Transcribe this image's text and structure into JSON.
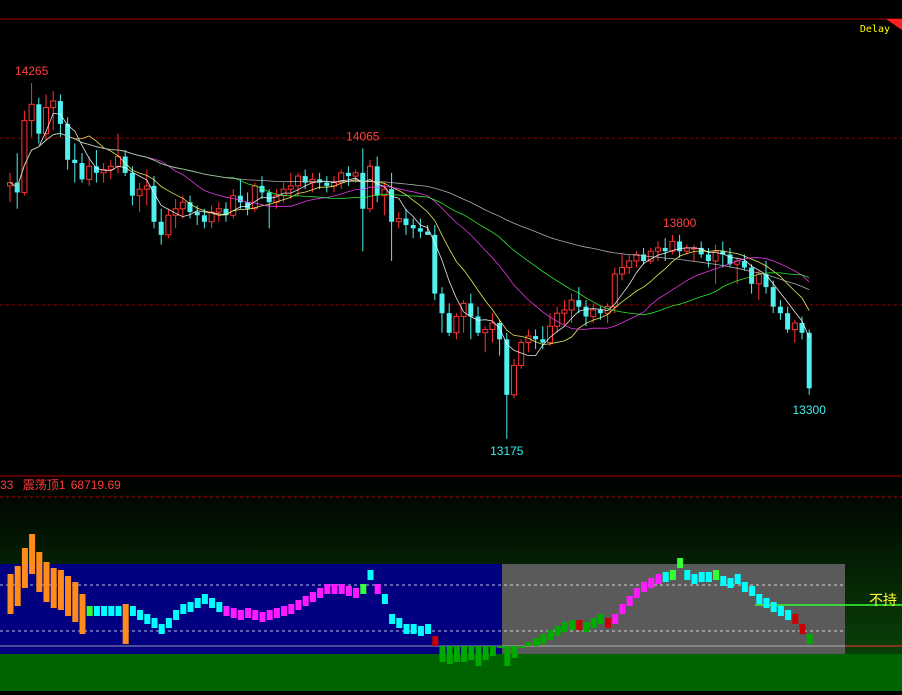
{
  "header": {
    "delay_label": "Delay"
  },
  "indicator": {
    "prefix": "33",
    "name": "震荡顶1",
    "value": "68719.69",
    "right_label": "不持"
  },
  "colors": {
    "up": "#ff3232",
    "down": "#4ef0f0",
    "label_high": "#ff4040",
    "label_low": "#3ff0f0",
    "ma5": "#ffffff",
    "ma10": "#ffff66",
    "ma20": "#ff3dff",
    "ma30": "#33ff33",
    "ma60": "#c0c0c0",
    "ind_orange": "#ff8c1a",
    "ind_cyan": "#00ffff",
    "ind_magenta": "#ff1aff",
    "ind_green": "#00aa00",
    "ind_red": "#cc0000",
    "ind_lime": "#33ff33",
    "panel_blue": "#000080",
    "panel_gray": "#5a5a5a"
  },
  "chart_data": {
    "type": "candlestick",
    "ylim": [
      13000,
      14400
    ],
    "price_labels": [
      {
        "text": "14265",
        "index": 3,
        "value": 14265,
        "kind": "high"
      },
      {
        "text": "14065",
        "index": 49,
        "value": 14065,
        "kind": "high"
      },
      {
        "text": "13800",
        "index": 93,
        "value": 13800,
        "kind": "high"
      },
      {
        "text": "13175",
        "index": 69,
        "value": 13175,
        "kind": "low"
      },
      {
        "text": "13300",
        "index": 111,
        "value": 13300,
        "kind": "low"
      }
    ],
    "candles": [
      [
        13950,
        13990,
        13900,
        13960
      ],
      [
        13960,
        14050,
        13880,
        13930
      ],
      [
        13930,
        14180,
        13920,
        14150
      ],
      [
        14150,
        14265,
        14100,
        14200
      ],
      [
        14200,
        14220,
        14080,
        14110
      ],
      [
        14110,
        14230,
        14090,
        14190
      ],
      [
        14190,
        14240,
        14120,
        14210
      ],
      [
        14210,
        14230,
        14100,
        14140
      ],
      [
        14140,
        14160,
        14000,
        14030
      ],
      [
        14030,
        14080,
        13960,
        14020
      ],
      [
        14020,
        14050,
        13960,
        13970
      ],
      [
        13970,
        14040,
        13950,
        14010
      ],
      [
        14010,
        14060,
        13960,
        13990
      ],
      [
        13990,
        14020,
        13960,
        14000
      ],
      [
        14000,
        14030,
        13970,
        14010
      ],
      [
        14010,
        14110,
        13990,
        14040
      ],
      [
        14040,
        14060,
        13980,
        13990
      ],
      [
        13990,
        14010,
        13890,
        13920
      ],
      [
        13920,
        13960,
        13870,
        13940
      ],
      [
        13940,
        14000,
        13890,
        13950
      ],
      [
        13950,
        13980,
        13820,
        13840
      ],
      [
        13840,
        13880,
        13770,
        13800
      ],
      [
        13800,
        13880,
        13790,
        13860
      ],
      [
        13860,
        13910,
        13820,
        13880
      ],
      [
        13880,
        13920,
        13850,
        13900
      ],
      [
        13900,
        13920,
        13850,
        13870
      ],
      [
        13870,
        13890,
        13830,
        13860
      ],
      [
        13860,
        13880,
        13820,
        13840
      ],
      [
        13840,
        13890,
        13820,
        13870
      ],
      [
        13870,
        13900,
        13840,
        13880
      ],
      [
        13880,
        13900,
        13840,
        13860
      ],
      [
        13860,
        13940,
        13850,
        13920
      ],
      [
        13920,
        13970,
        13880,
        13900
      ],
      [
        13900,
        13930,
        13860,
        13880
      ],
      [
        13880,
        13960,
        13870,
        13950
      ],
      [
        13950,
        13980,
        13910,
        13930
      ],
      [
        13930,
        13940,
        13820,
        13900
      ],
      [
        13900,
        13940,
        13880,
        13920
      ],
      [
        13920,
        13960,
        13900,
        13940
      ],
      [
        13940,
        13990,
        13910,
        13950
      ],
      [
        13950,
        13990,
        13920,
        13980
      ],
      [
        13980,
        14000,
        13940,
        13960
      ],
      [
        13960,
        13990,
        13930,
        13970
      ],
      [
        13970,
        13990,
        13940,
        13960
      ],
      [
        13960,
        13980,
        13930,
        13950
      ],
      [
        13950,
        13980,
        13930,
        13960
      ],
      [
        13960,
        14000,
        13940,
        13990
      ],
      [
        13990,
        14010,
        13950,
        13980
      ],
      [
        13980,
        14000,
        13960,
        13990
      ],
      [
        13990,
        14065,
        13750,
        13880
      ],
      [
        13880,
        14030,
        13870,
        14010
      ],
      [
        14010,
        14040,
        13900,
        13920
      ],
      [
        13920,
        13960,
        13860,
        13940
      ],
      [
        13940,
        13990,
        13720,
        13840
      ],
      [
        13840,
        13870,
        13820,
        13850
      ],
      [
        13850,
        13880,
        13800,
        13830
      ],
      [
        13830,
        13850,
        13790,
        13820
      ],
      [
        13820,
        13850,
        13790,
        13810
      ],
      [
        13810,
        13830,
        13800,
        13800
      ],
      [
        13800,
        13830,
        13600,
        13620
      ],
      [
        13620,
        13640,
        13500,
        13560
      ],
      [
        13560,
        13590,
        13490,
        13500
      ],
      [
        13500,
        13560,
        13480,
        13550
      ],
      [
        13550,
        13600,
        13500,
        13590
      ],
      [
        13590,
        13620,
        13480,
        13550
      ],
      [
        13550,
        13580,
        13490,
        13500
      ],
      [
        13500,
        13520,
        13440,
        13510
      ],
      [
        13510,
        13560,
        13470,
        13530
      ],
      [
        13530,
        13540,
        13430,
        13480
      ],
      [
        13480,
        13500,
        13175,
        13310
      ],
      [
        13310,
        13420,
        13300,
        13400
      ],
      [
        13400,
        13480,
        13390,
        13470
      ],
      [
        13470,
        13510,
        13440,
        13490
      ],
      [
        13490,
        13510,
        13450,
        13480
      ],
      [
        13480,
        13520,
        13450,
        13470
      ],
      [
        13470,
        13560,
        13460,
        13520
      ],
      [
        13520,
        13580,
        13500,
        13560
      ],
      [
        13560,
        13600,
        13520,
        13570
      ],
      [
        13570,
        13620,
        13530,
        13600
      ],
      [
        13600,
        13640,
        13560,
        13580
      ],
      [
        13580,
        13600,
        13520,
        13550
      ],
      [
        13550,
        13590,
        13530,
        13570
      ],
      [
        13570,
        13580,
        13540,
        13560
      ],
      [
        13560,
        13590,
        13530,
        13580
      ],
      [
        13580,
        13700,
        13560,
        13680
      ],
      [
        13680,
        13740,
        13660,
        13700
      ],
      [
        13700,
        13740,
        13680,
        13720
      ],
      [
        13720,
        13750,
        13700,
        13740
      ],
      [
        13740,
        13760,
        13710,
        13720
      ],
      [
        13720,
        13760,
        13710,
        13750
      ],
      [
        13750,
        13780,
        13720,
        13760
      ],
      [
        13760,
        13790,
        13720,
        13750
      ],
      [
        13750,
        13800,
        13740,
        13780
      ],
      [
        13780,
        13800,
        13730,
        13750
      ],
      [
        13750,
        13770,
        13740,
        13760
      ],
      [
        13760,
        13770,
        13720,
        13760
      ],
      [
        13760,
        13780,
        13730,
        13740
      ],
      [
        13740,
        13760,
        13700,
        13720
      ],
      [
        13720,
        13770,
        13650,
        13750
      ],
      [
        13750,
        13780,
        13700,
        13740
      ],
      [
        13740,
        13760,
        13700,
        13710
      ],
      [
        13710,
        13730,
        13650,
        13720
      ],
      [
        13720,
        13740,
        13690,
        13700
      ],
      [
        13700,
        13710,
        13620,
        13650
      ],
      [
        13650,
        13690,
        13600,
        13680
      ],
      [
        13680,
        13720,
        13620,
        13640
      ],
      [
        13640,
        13660,
        13560,
        13580
      ],
      [
        13580,
        13600,
        13540,
        13560
      ],
      [
        13560,
        13580,
        13500,
        13510
      ],
      [
        13510,
        13540,
        13470,
        13530
      ],
      [
        13530,
        13550,
        13480,
        13500
      ],
      [
        13500,
        13510,
        13310,
        13330
      ]
    ],
    "indicator": [
      [
        50,
        "o"
      ],
      [
        54,
        "o"
      ],
      [
        63,
        "o"
      ],
      [
        70,
        "o"
      ],
      [
        61,
        "o"
      ],
      [
        56,
        "o"
      ],
      [
        53,
        "o"
      ],
      [
        52,
        "o"
      ],
      [
        49,
        "o"
      ],
      [
        46,
        "o"
      ],
      [
        40,
        "o"
      ],
      [
        34,
        "l"
      ],
      [
        34,
        "c"
      ],
      [
        34,
        "c"
      ],
      [
        34,
        "c"
      ],
      [
        34,
        "c"
      ],
      [
        35,
        "o"
      ],
      [
        34,
        "c"
      ],
      [
        32,
        "c"
      ],
      [
        30,
        "c"
      ],
      [
        28,
        "c"
      ],
      [
        25,
        "c"
      ],
      [
        28,
        "c"
      ],
      [
        32,
        "c"
      ],
      [
        35,
        "c"
      ],
      [
        36,
        "c"
      ],
      [
        38,
        "c"
      ],
      [
        40,
        "c"
      ],
      [
        38,
        "c"
      ],
      [
        36,
        "c"
      ],
      [
        34,
        "m"
      ],
      [
        33,
        "m"
      ],
      [
        32,
        "m"
      ],
      [
        33,
        "m"
      ],
      [
        32,
        "m"
      ],
      [
        31,
        "m"
      ],
      [
        32,
        "m"
      ],
      [
        33,
        "m"
      ],
      [
        34,
        "m"
      ],
      [
        35,
        "m"
      ],
      [
        37,
        "m"
      ],
      [
        39,
        "m"
      ],
      [
        41,
        "m"
      ],
      [
        43,
        "m"
      ],
      [
        45,
        "m"
      ],
      [
        45,
        "m"
      ],
      [
        45,
        "m"
      ],
      [
        44,
        "m"
      ],
      [
        43,
        "m"
      ],
      [
        45,
        "l"
      ],
      [
        52,
        "c"
      ],
      [
        45,
        "m"
      ],
      [
        40,
        "c"
      ],
      [
        30,
        "c"
      ],
      [
        28,
        "c"
      ],
      [
        25,
        "c"
      ],
      [
        25,
        "c"
      ],
      [
        24,
        "c"
      ],
      [
        25,
        "c"
      ],
      [
        19,
        "r"
      ],
      [
        10,
        "g"
      ],
      [
        9,
        "g"
      ],
      [
        10,
        "g"
      ],
      [
        10,
        "g"
      ],
      [
        11,
        "g"
      ],
      [
        8,
        "g"
      ],
      [
        11,
        "g"
      ],
      [
        13,
        "g"
      ],
      [
        14,
        "g"
      ],
      [
        8,
        "g"
      ],
      [
        12,
        "g"
      ],
      [
        14,
        "g"
      ],
      [
        16,
        "g"
      ],
      [
        18,
        "g"
      ],
      [
        20,
        "g"
      ],
      [
        22,
        "g"
      ],
      [
        24,
        "g"
      ],
      [
        26,
        "g"
      ],
      [
        27,
        "g"
      ],
      [
        27,
        "r"
      ],
      [
        26,
        "g"
      ],
      [
        28,
        "g"
      ],
      [
        30,
        "g"
      ],
      [
        28,
        "r"
      ],
      [
        30,
        "m"
      ],
      [
        35,
        "m"
      ],
      [
        39,
        "m"
      ],
      [
        43,
        "m"
      ],
      [
        46,
        "m"
      ],
      [
        48,
        "m"
      ],
      [
        50,
        "m"
      ],
      [
        51,
        "c"
      ],
      [
        52,
        "l"
      ],
      [
        58,
        "l"
      ],
      [
        52,
        "c"
      ],
      [
        50,
        "c"
      ],
      [
        51,
        "c"
      ],
      [
        51,
        "c"
      ],
      [
        52,
        "l"
      ],
      [
        49,
        "c"
      ],
      [
        48,
        "c"
      ],
      [
        50,
        "c"
      ],
      [
        46,
        "c"
      ],
      [
        44,
        "c"
      ],
      [
        40,
        "c"
      ],
      [
        38,
        "c"
      ],
      [
        36,
        "c"
      ],
      [
        34,
        "c"
      ],
      [
        32,
        "c"
      ],
      [
        30,
        "r"
      ],
      [
        25,
        "r"
      ],
      [
        20,
        "g"
      ]
    ]
  }
}
